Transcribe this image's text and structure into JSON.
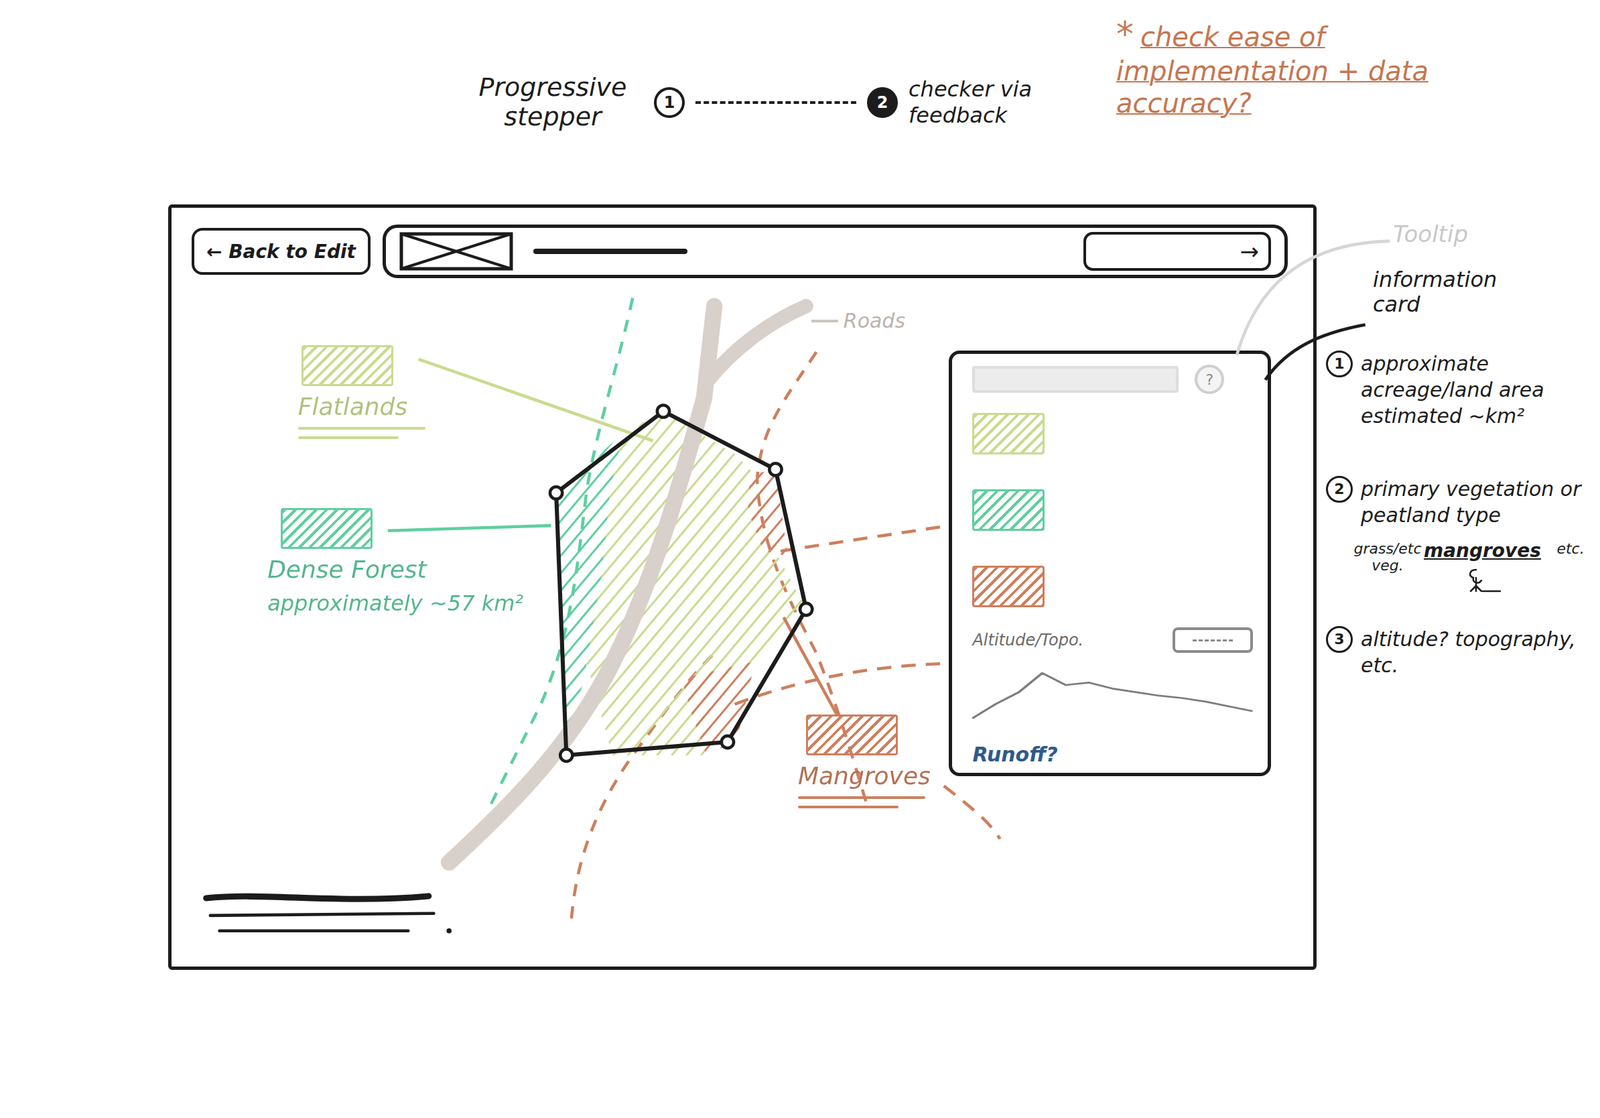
{
  "stepper": {
    "title": "Progressive stepper",
    "steps": [
      {
        "label": "1",
        "selected": false
      },
      {
        "label": "2",
        "selected": true
      }
    ],
    "note": "checker via feedback"
  },
  "annotation": {
    "mark": "*",
    "text": "check ease of implementation + data accuracy?"
  },
  "toolbar": {
    "back": "← Back to Edit",
    "next": "→"
  },
  "map": {
    "roads_label": "Roads",
    "regions": [
      {
        "name": "Flatlands",
        "color": "#c9db8f"
      },
      {
        "name": "Dense Forest",
        "detail": "approximately ~57 km²",
        "color": "#5fcf9f"
      },
      {
        "name": "Mangroves",
        "color": "#cd7f5e"
      }
    ]
  },
  "info_card": {
    "help": "?",
    "chart": {
      "title": "Altitude/Topo.",
      "values": [
        8,
        20,
        30,
        46,
        36,
        38,
        33,
        30,
        27,
        25,
        22,
        18,
        14
      ]
    },
    "footer": "Runoff?"
  },
  "notes": {
    "tooltip": "Tooltip",
    "card": "information card",
    "items": [
      {
        "number": "1",
        "text": "approximate acreage/land area estimated ~km²"
      },
      {
        "number": "2",
        "text": "primary vegetation or peatland type",
        "branches": [
          "grass/etc veg.",
          "mangroves",
          "etc."
        ]
      },
      {
        "number": "3",
        "text": "altitude? topography, etc."
      }
    ]
  }
}
